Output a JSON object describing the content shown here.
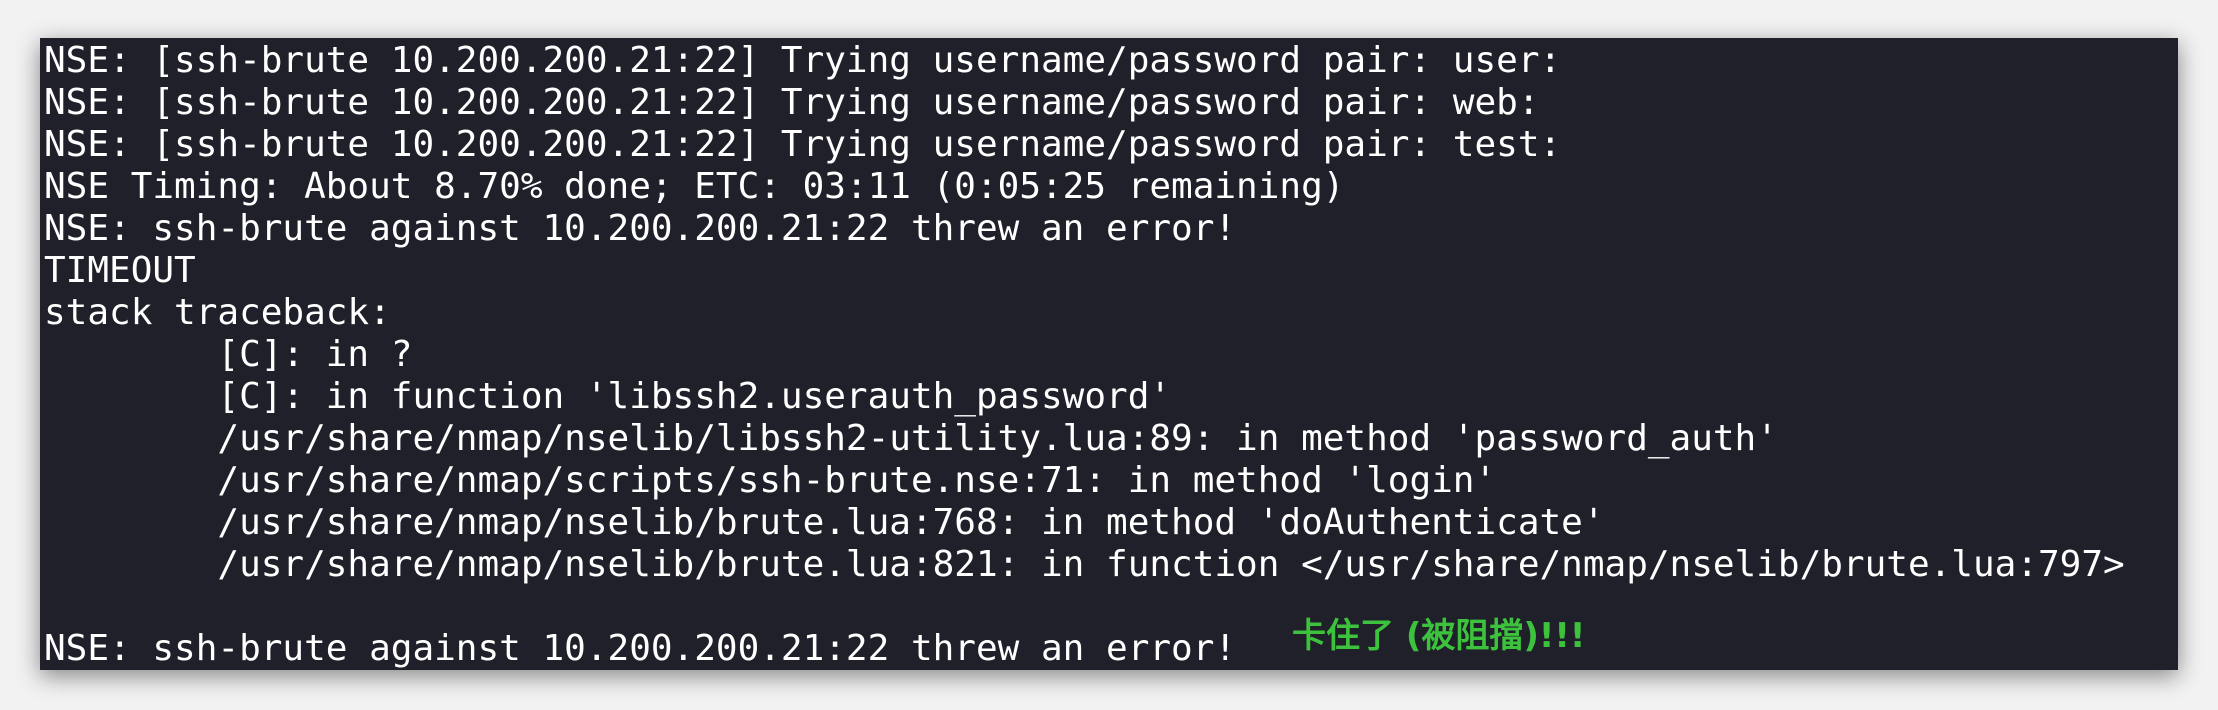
{
  "terminal": {
    "lines": [
      "NSE: [ssh-brute 10.200.200.21:22] Trying username/password pair: user:",
      "NSE: [ssh-brute 10.200.200.21:22] Trying username/password pair: web:",
      "NSE: [ssh-brute 10.200.200.21:22] Trying username/password pair: test:",
      "NSE Timing: About 8.70% done; ETC: 03:11 (0:05:25 remaining)",
      "NSE: ssh-brute against 10.200.200.21:22 threw an error!",
      "TIMEOUT",
      "stack traceback:",
      "        [C]: in ?",
      "        [C]: in function 'libssh2.userauth_password'",
      "        /usr/share/nmap/nselib/libssh2-utility.lua:89: in method 'password_auth'",
      "        /usr/share/nmap/scripts/ssh-brute.nse:71: in method 'login'",
      "        /usr/share/nmap/nselib/brute.lua:768: in method 'doAuthenticate'",
      "        /usr/share/nmap/nselib/brute.lua:821: in function </usr/share/nmap/nselib/brute.lua:797>",
      "",
      "NSE: ssh-brute against 10.200.200.21:22 threw an error!"
    ]
  },
  "annotation": {
    "text": "卡住了 (被阻擋)!!!",
    "color": "#3cc23c"
  }
}
